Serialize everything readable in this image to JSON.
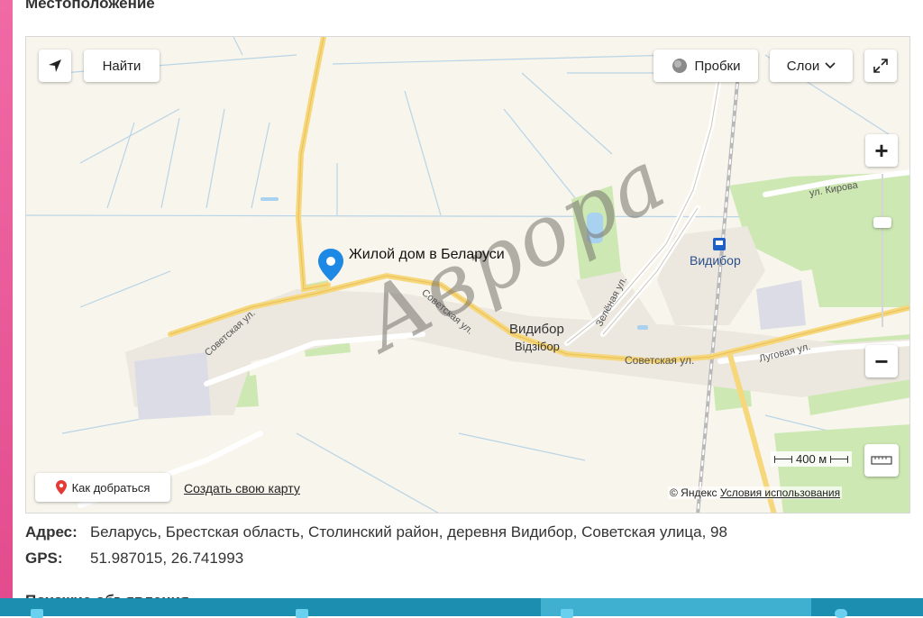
{
  "section": {
    "title": "Местоположение"
  },
  "map": {
    "controls": {
      "find": "Найти",
      "traffic": "Пробки",
      "layers": "Слои",
      "zoom_in": "+",
      "zoom_out": "−"
    },
    "marker_label": "Жилой дом в Беларуси",
    "place_labels": {
      "village": "Видибор",
      "village_be": "Відзібор",
      "station": "Видибор"
    },
    "streets": {
      "sovetskaya_1": "Советская ул.",
      "sovetskaya_2": "Советская ул.",
      "sovetskaya_3": "Советская ул.",
      "kirova": "ул. Кирова",
      "lugovaya": "Луговая ул.",
      "zelenaya": "Зелёная ул."
    },
    "scale": "400 м",
    "route_button": "Как добраться",
    "create_map": "Создать свою карту",
    "copyright": "© Яндекс",
    "terms": "Условия использования",
    "watermark": "Аврора",
    "colors": {
      "road": "#f6d77c",
      "green": "#cde8b2",
      "marker": "#1e88e5",
      "route_pin": "#e53935"
    }
  },
  "info": {
    "address_label": "Адрес:",
    "address_value": "Беларусь, Брестская область, Столинский район, деревня Видибор, Советская улица, 98",
    "gps_label": "GPS:",
    "gps_value": "51.987015, 26.741993"
  },
  "next": {
    "title": "Похожие объявления"
  }
}
